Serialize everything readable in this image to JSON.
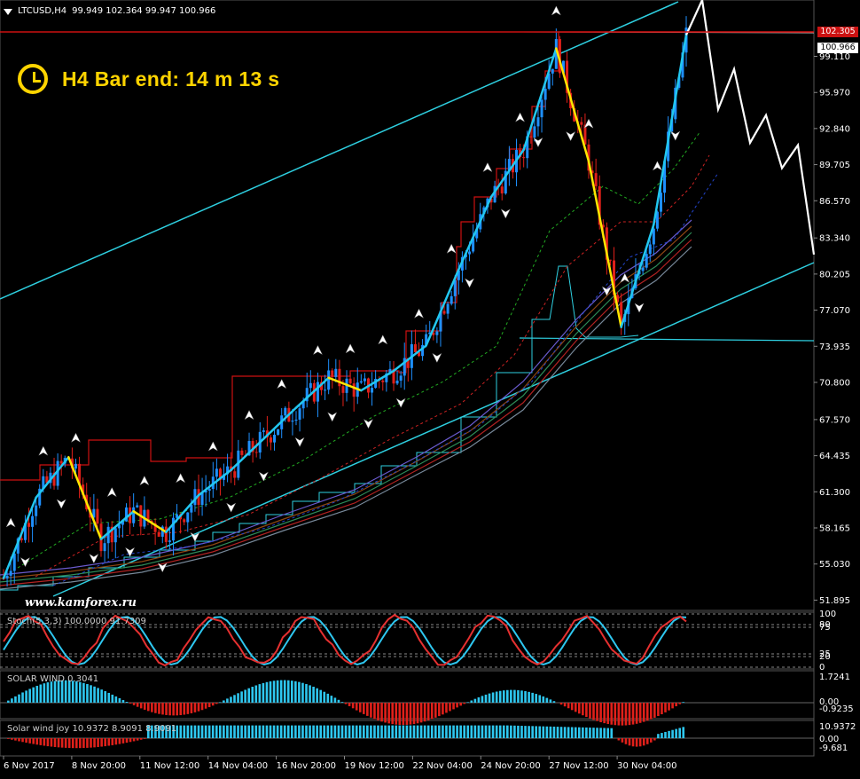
{
  "header": {
    "symbol": "LTCUSD,H4",
    "ohlc": "99.949 102.364 99.947 100.966"
  },
  "hud": {
    "bar_end_text": "H4 Bar end: 14 m 13 s",
    "icon": "clock-icon"
  },
  "watermark": "www.kamforex.ru",
  "colors": {
    "background": "#000000",
    "bull_candle": "#1e90ff",
    "bear_candle": "#e0201a",
    "channel": "#2ecfe0",
    "resistance": "#cc1111",
    "forecast": "#ffffff",
    "hma_up": "#22c7f0",
    "hma_down": "#ffe600",
    "stoch_main": "#e53030",
    "stoch_signal": "#2ec7f0",
    "histogram_pos": "#2ec7f0",
    "histogram_neg": "#e0201a"
  },
  "price_tags": {
    "current": "100.966",
    "high_line": "102.305"
  },
  "subpanels": {
    "stoch": {
      "label": "Stoch(5,3,3) 100.0000 91.7309",
      "levels": [
        "100",
        "80",
        "75",
        "25",
        "20",
        "0"
      ]
    },
    "solar": {
      "label": "SOLAR WIND 0.3041",
      "levels": [
        "1.7241",
        "0.00",
        "-0.9235"
      ]
    },
    "solar2": {
      "label": "Solar wind joy 10.9372 8.9091 8.9091",
      "levels": [
        "10.9372",
        "0.00",
        "-9.681"
      ]
    }
  },
  "chart_data": {
    "type": "candlestick",
    "title": "LTCUSD,H4",
    "y_ticks": [
      "99.110",
      "95.970",
      "92.840",
      "89.705",
      "86.570",
      "83.340",
      "80.205",
      "77.070",
      "73.935",
      "70.800",
      "67.570",
      "64.435",
      "61.300",
      "58.165",
      "55.030",
      "51.895"
    ],
    "x_ticks": [
      "6 Nov 2017",
      "8 Nov 20:00",
      "11 Nov 12:00",
      "14 Nov 04:00",
      "16 Nov 20:00",
      "19 Nov 12:00",
      "22 Nov 04:00",
      "24 Nov 20:00",
      "27 Nov 12:00",
      "30 Nov 04:00"
    ],
    "ylim": [
      51.0,
      104.0
    ],
    "grid": false,
    "close_path": [
      {
        "x": "6 Nov 2017",
        "y": 53.8
      },
      {
        "x": "7 Nov 12:00",
        "y": 60.8
      },
      {
        "x": "8 Nov 20:00",
        "y": 64.3
      },
      {
        "x": "10 Nov 00:00",
        "y": 57.2
      },
      {
        "x": "11 Nov 12:00",
        "y": 59.6
      },
      {
        "x": "12 Nov 16:00",
        "y": 57.8
      },
      {
        "x": "14 Nov 04:00",
        "y": 61.0
      },
      {
        "x": "15 Nov 12:00",
        "y": 63.2
      },
      {
        "x": "16 Nov 20:00",
        "y": 65.9
      },
      {
        "x": "18 Nov 04:00",
        "y": 68.6
      },
      {
        "x": "19 Nov 12:00",
        "y": 71.2
      },
      {
        "x": "20 Nov 20:00",
        "y": 70.1
      },
      {
        "x": "22 Nov 04:00",
        "y": 71.8
      },
      {
        "x": "23 Nov 12:00",
        "y": 74.0
      },
      {
        "x": "24 Nov 20:00",
        "y": 80.6
      },
      {
        "x": "25 Nov 20:00",
        "y": 86.9
      },
      {
        "x": "27 Nov 12:00",
        "y": 91.0
      },
      {
        "x": "28 Nov 04:00",
        "y": 99.8
      },
      {
        "x": "28 Nov 20:00",
        "y": 90.0
      },
      {
        "x": "29 Nov 16:00",
        "y": 75.6
      },
      {
        "x": "30 Nov 04:00",
        "y": 84.5
      },
      {
        "x": "30 Nov 16:00",
        "y": 100.966
      }
    ],
    "forecast": [
      {
        "x": "30 Nov 16:00",
        "y": 100.966
      },
      {
        "x": "1 Dec 00:00",
        "y": 104.0
      },
      {
        "x": "1 Dec 08:00",
        "y": 94.5
      },
      {
        "x": "1 Dec 16:00",
        "y": 98.0
      },
      {
        "x": "2 Dec 00:00",
        "y": 91.6
      },
      {
        "x": "2 Dec 08:00",
        "y": 94.0
      },
      {
        "x": "2 Dec 16:00",
        "y": 89.4
      },
      {
        "x": "3 Dec 00:00",
        "y": 91.4
      },
      {
        "x": "3 Dec 08:00",
        "y": 81.9
      }
    ],
    "levels": {
      "resistance": 102.305,
      "support": 75.7
    }
  }
}
